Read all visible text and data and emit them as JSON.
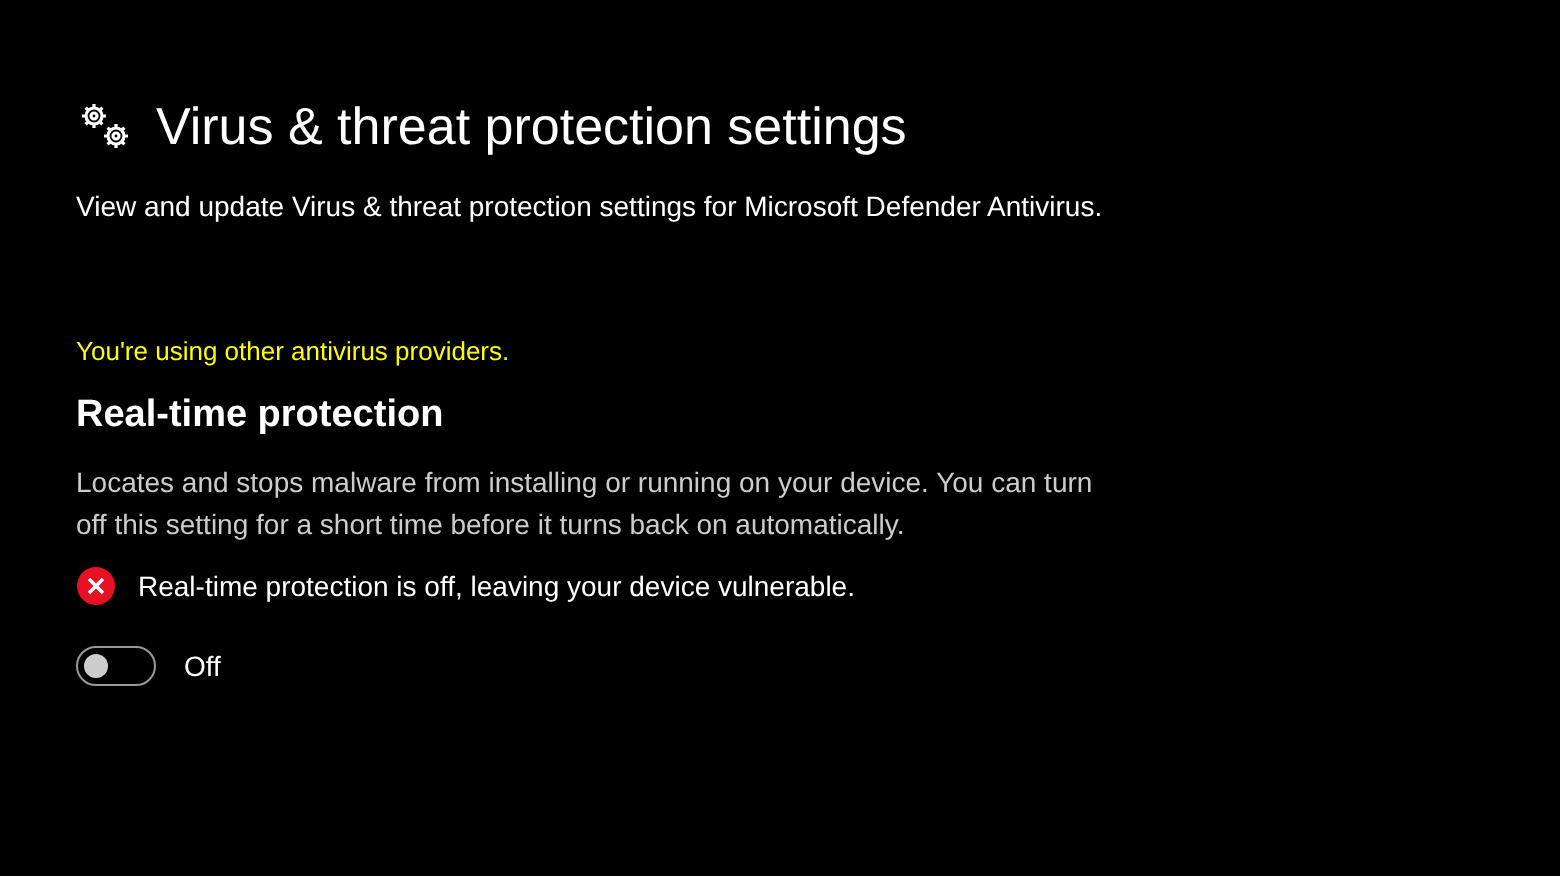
{
  "page": {
    "title": "Virus & threat protection settings",
    "description": "View and update Virus & threat protection settings for Microsoft Defender Antivirus."
  },
  "notice": "You're using other antivirus providers.",
  "section": {
    "heading": "Real-time protection",
    "description": "Locates and stops malware from installing or running on your device. You can turn off this setting for a short time before it turns back on automatically.",
    "alert": {
      "kind": "error",
      "text": "Real-time protection is off, leaving your device vulnerable."
    },
    "toggle": {
      "on": false,
      "label": "Off"
    }
  }
}
